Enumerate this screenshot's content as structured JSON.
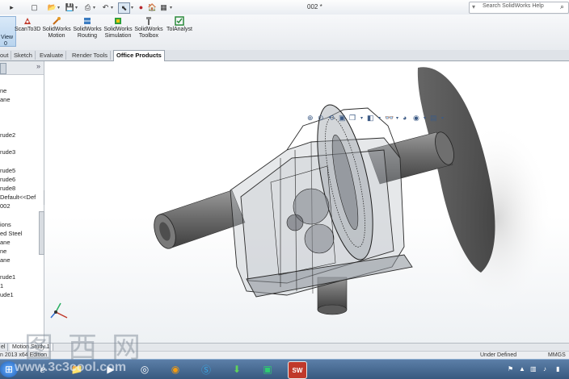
{
  "window": {
    "title": "002 *"
  },
  "quick_access": {
    "icons": [
      "new-document-icon",
      "open-icon",
      "save-icon",
      "print-icon",
      "undo-icon",
      "select-icon",
      "rebuild-icon",
      "file-properties-icon",
      "options-icon"
    ]
  },
  "search": {
    "placeholder": "Search SolidWorks Help"
  },
  "ribbon": {
    "buttons": [
      {
        "label_1": "View",
        "label_2": "0"
      },
      {
        "label_1": "ScanTo3D",
        "label_2": ""
      },
      {
        "label_1": "SolidWorks",
        "label_2": "Motion"
      },
      {
        "label_1": "SolidWorks",
        "label_2": "Routing"
      },
      {
        "label_1": "SolidWorks",
        "label_2": "Simulation"
      },
      {
        "label_1": "SolidWorks",
        "label_2": "Toolbox"
      },
      {
        "label_1": "TolAnalyst",
        "label_2": ""
      }
    ]
  },
  "tabs": [
    "out",
    "Sketch",
    "Evaluate",
    "Render Tools",
    "Office Products"
  ],
  "active_tab": "Office Products",
  "feature_tree": {
    "items": [
      "ne",
      "ane",
      "",
      "",
      "",
      "rude2",
      "",
      "rude3",
      "",
      "rude5",
      "rude6",
      "rude8",
      "Default<<Def",
      "002",
      "",
      "ions",
      "ed Steel",
      "ane",
      "ne",
      "ane",
      "",
      "rude1",
      "1",
      "ude1"
    ]
  },
  "motion_tabs": [
    "el",
    "Motion Study 1"
  ],
  "status": {
    "left": "n 2013 x64 Edition",
    "center": "Under Defined",
    "right": "MMGS"
  },
  "watermark": {
    "chars": "图西网",
    "url": "www.3c3cool.com"
  },
  "colors": {
    "accent": "#3d6fa8",
    "taskbar": "#3f6289",
    "part_gray": "#6c6c6c"
  }
}
